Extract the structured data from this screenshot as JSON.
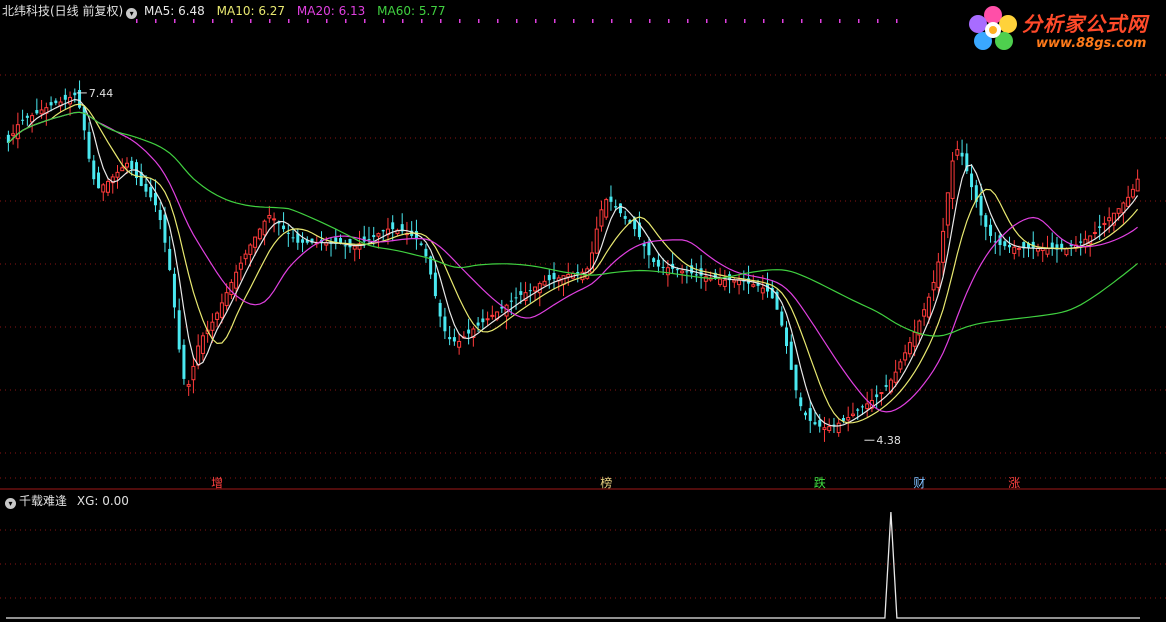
{
  "main_header": {
    "stock": "北纬科技(日线 前复权)",
    "ma5": "MA5: 6.48",
    "ma10": "MA10: 6.27",
    "ma20": "MA20: 6.13",
    "ma60": "MA60: 5.77"
  },
  "sub_header": {
    "indicator": "千载难逢",
    "xg": "XG: 0.00"
  },
  "logo": {
    "title": "分析家公式网",
    "url": "www.88gs.com"
  },
  "colors": {
    "up": "#ff3b3b",
    "down": "#4ae8f0",
    "ma5": "#e8e8e8",
    "ma10": "#e8e870",
    "ma20": "#e040e0",
    "ma60": "#40d040",
    "grid": "#8a1414"
  },
  "chart_data": [
    {
      "type": "candlestick",
      "title": "北纬科技(日线 前复权)",
      "ylim": [
        4.1,
        8.1
      ],
      "annotations": [
        {
          "label": "7.44",
          "bar": 14,
          "price": 7.44
        },
        {
          "label": "4.38",
          "bar": 180,
          "price": 4.38
        }
      ],
      "markers": [
        {
          "label": "增",
          "bar": 44,
          "color": "#ff4040"
        },
        {
          "label": "榜",
          "bar": 126,
          "color": "#e8d080"
        },
        {
          "label": "跌",
          "bar": 171,
          "color": "#40e040"
        },
        {
          "label": "财",
          "bar": 192,
          "color": "#80c0ff"
        },
        {
          "label": "涨",
          "bar": 212,
          "color": "#ff4040"
        }
      ],
      "series": [
        {
          "name": "MA5",
          "value": 6.48
        },
        {
          "name": "MA10",
          "value": 6.27
        },
        {
          "name": "MA20",
          "value": 6.13
        },
        {
          "name": "MA60",
          "value": 5.77
        }
      ],
      "close": [
        7.0,
        7.08,
        7.16,
        7.2,
        7.22,
        7.24,
        7.26,
        7.29,
        7.31,
        7.33,
        7.35,
        7.36,
        7.38,
        7.4,
        7.42,
        7.31,
        7.11,
        6.86,
        6.68,
        6.6,
        6.63,
        6.66,
        6.7,
        6.74,
        6.78,
        6.82,
        6.77,
        6.69,
        6.62,
        6.57,
        6.52,
        6.45,
        6.32,
        6.12,
        5.88,
        5.55,
        5.18,
        4.92,
        4.87,
        5.03,
        5.21,
        5.3,
        5.35,
        5.42,
        5.5,
        5.59,
        5.68,
        5.77,
        5.86,
        5.94,
        6.02,
        6.1,
        6.17,
        6.24,
        6.31,
        6.36,
        6.33,
        6.29,
        6.24,
        6.2,
        6.16,
        6.12,
        6.12,
        6.12,
        6.12,
        6.12,
        6.12,
        6.12,
        6.11,
        6.11,
        6.11,
        6.09,
        6.08,
        6.09,
        6.11,
        6.13,
        6.15,
        6.17,
        6.2,
        6.22,
        6.24,
        6.24,
        6.23,
        6.22,
        6.2,
        6.18,
        6.15,
        6.1,
        6.0,
        5.84,
        5.65,
        5.47,
        5.34,
        5.27,
        5.25,
        5.25,
        5.29,
        5.32,
        5.36,
        5.39,
        5.42,
        5.45,
        5.48,
        5.51,
        5.54,
        5.57,
        5.6,
        5.63,
        5.66,
        5.68,
        5.7,
        5.73,
        5.76,
        5.78,
        5.79,
        5.8,
        5.81,
        5.83,
        5.84,
        5.85,
        5.85,
        5.86,
        5.89,
        6.03,
        6.24,
        6.41,
        6.5,
        6.48,
        6.43,
        6.38,
        6.33,
        6.29,
        6.24,
        6.17,
        6.09,
        6.01,
        5.95,
        5.91,
        5.9,
        5.9,
        5.89,
        5.88,
        5.87,
        5.86,
        5.85,
        5.84,
        5.83,
        5.82,
        5.81,
        5.8,
        5.8,
        5.79,
        5.79,
        5.79,
        5.79,
        5.78,
        5.76,
        5.75,
        5.74,
        5.72,
        5.69,
        5.63,
        5.53,
        5.39,
        5.21,
        5.0,
        4.82,
        4.68,
        4.6,
        4.55,
        4.52,
        4.5,
        4.49,
        4.5,
        4.51,
        4.53,
        4.55,
        4.58,
        4.61,
        4.64,
        4.67,
        4.7,
        4.73,
        4.76,
        4.8,
        4.85,
        4.91,
        4.98,
        5.07,
        5.15,
        5.24,
        5.33,
        5.43,
        5.53,
        5.64,
        5.77,
        5.95,
        6.22,
        6.56,
        6.84,
        6.94,
        6.88,
        6.75,
        6.61,
        6.48,
        6.36,
        6.26,
        6.18,
        6.13,
        6.1,
        6.09,
        6.08,
        6.08,
        6.07,
        6.07,
        6.07,
        6.07,
        6.07,
        6.07,
        6.07,
        6.07,
        6.06,
        6.07,
        6.07,
        6.09,
        6.1,
        6.12,
        6.15,
        6.18,
        6.21,
        6.25,
        6.29,
        6.34,
        6.38,
        6.42,
        6.47,
        6.52,
        6.59,
        6.68
      ],
      "ma20_value": 6.13,
      "ma60_value": 5.77
    },
    {
      "type": "line",
      "title": "千载难逢",
      "ylim": [
        0,
        1
      ],
      "spike_bar": 186,
      "value": 0.0
    }
  ]
}
